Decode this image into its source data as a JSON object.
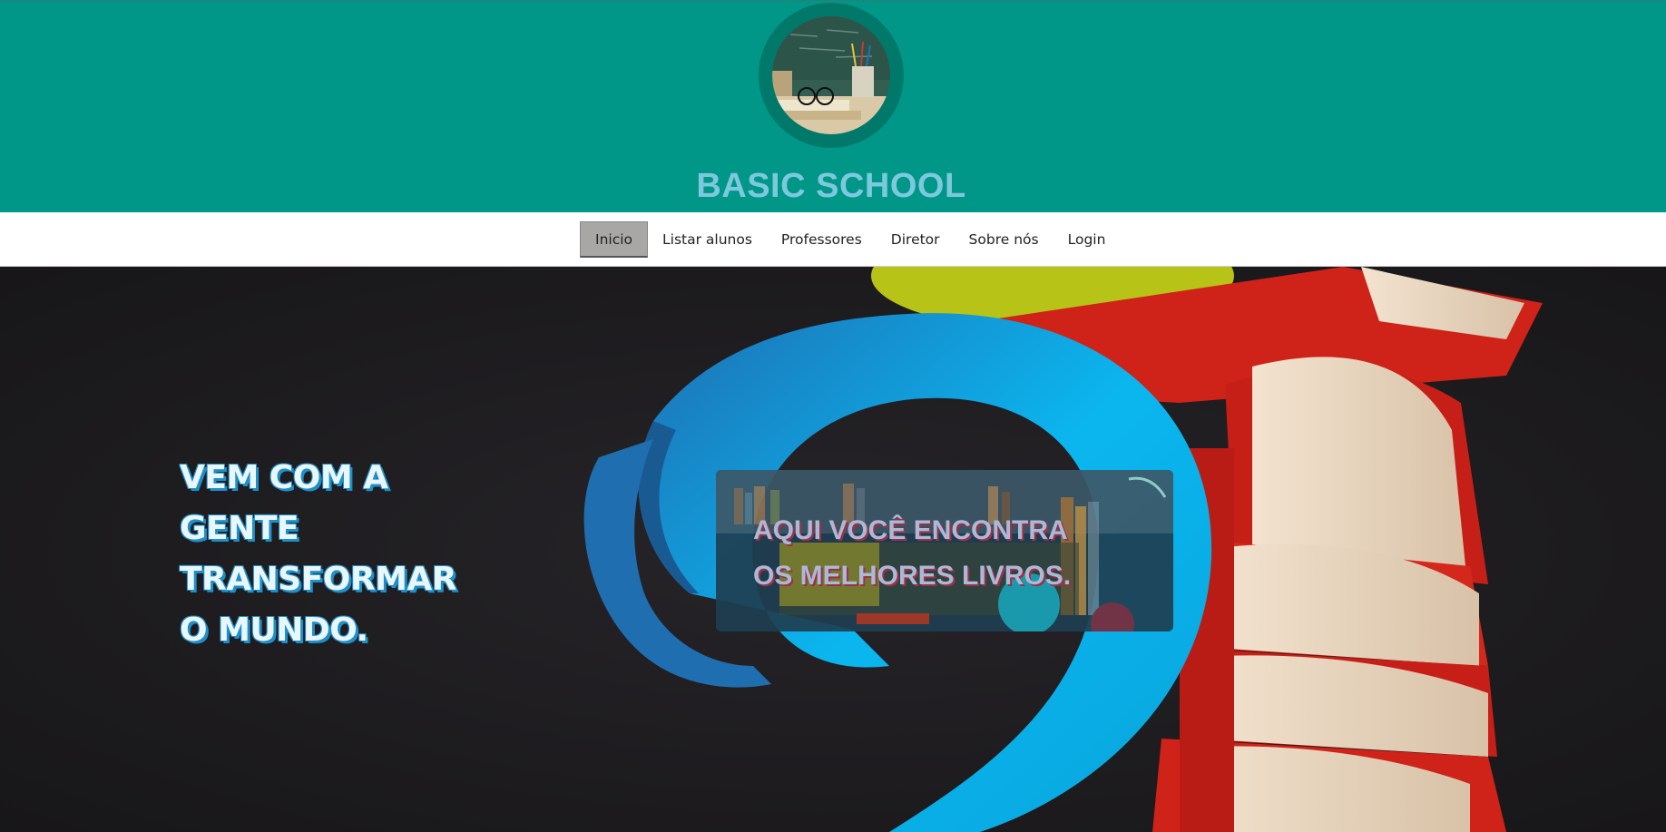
{
  "header": {
    "site_title": "BASIC SCHOOL",
    "logo_icon": "school-desk-logo-icon"
  },
  "nav": {
    "items": [
      {
        "label": "Inicio",
        "active": true
      },
      {
        "label": "Listar alunos",
        "active": false
      },
      {
        "label": "Professores",
        "active": false
      },
      {
        "label": "Diretor",
        "active": false
      },
      {
        "label": "Sobre nós",
        "active": false
      },
      {
        "label": "Login",
        "active": false
      }
    ]
  },
  "hero": {
    "headline_lines": [
      "VEM COM A",
      "GENTE",
      "TRANSFORMAR",
      "O MUNDO."
    ],
    "promo_lines": [
      "AQUI VOCÊ ENCONTRA",
      "OS MELHORES LIVROS."
    ]
  },
  "colors": {
    "header_bg": "#009688",
    "logo_ring": "#00796b",
    "title": "#7cc8dd",
    "active_nav_bg": "#a9a6a6",
    "hero_bg": "#1b1a1c"
  }
}
